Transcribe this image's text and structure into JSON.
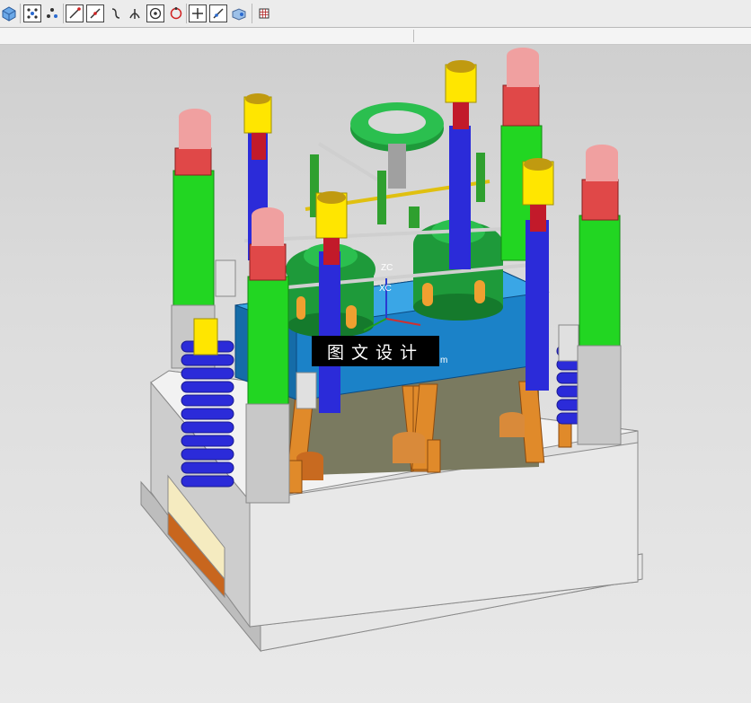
{
  "toolbar": {
    "buttons": [
      {
        "name": "view-cube-icon",
        "label": ""
      },
      {
        "name": "snap-points-icon",
        "label": ""
      },
      {
        "name": "snap-midpoint-icon",
        "label": ""
      },
      {
        "name": "line-endpoint-icon",
        "label": ""
      },
      {
        "name": "line-midpoint-icon",
        "label": ""
      },
      {
        "name": "curve-point-icon",
        "label": ""
      },
      {
        "name": "intersection-icon",
        "label": ""
      },
      {
        "name": "arc-center-icon",
        "label": ""
      },
      {
        "name": "quadrant-point-icon",
        "label": ""
      },
      {
        "name": "point-on-curve-icon",
        "label": ""
      },
      {
        "name": "point-on-face-icon",
        "label": ""
      },
      {
        "name": "face-snap-icon",
        "label": ""
      },
      {
        "name": "grid-icon",
        "label": ""
      }
    ]
  },
  "viewport": {
    "axis_labels": {
      "zc": "ZC",
      "xc": "XC",
      "partial": "m"
    },
    "watermark": "图文设计"
  },
  "colors": {
    "plate_gray": "#dcdcdc",
    "cavity_blue": "#1d8ed6",
    "pillar_green": "#22d622",
    "spring_blue": "#2b2bd9",
    "cap_yellow": "#ffe600",
    "cap_red": "#e04848",
    "cap_pink": "#f0a0a0",
    "core_green": "#1fa03c",
    "orange": "#e08a2a"
  }
}
